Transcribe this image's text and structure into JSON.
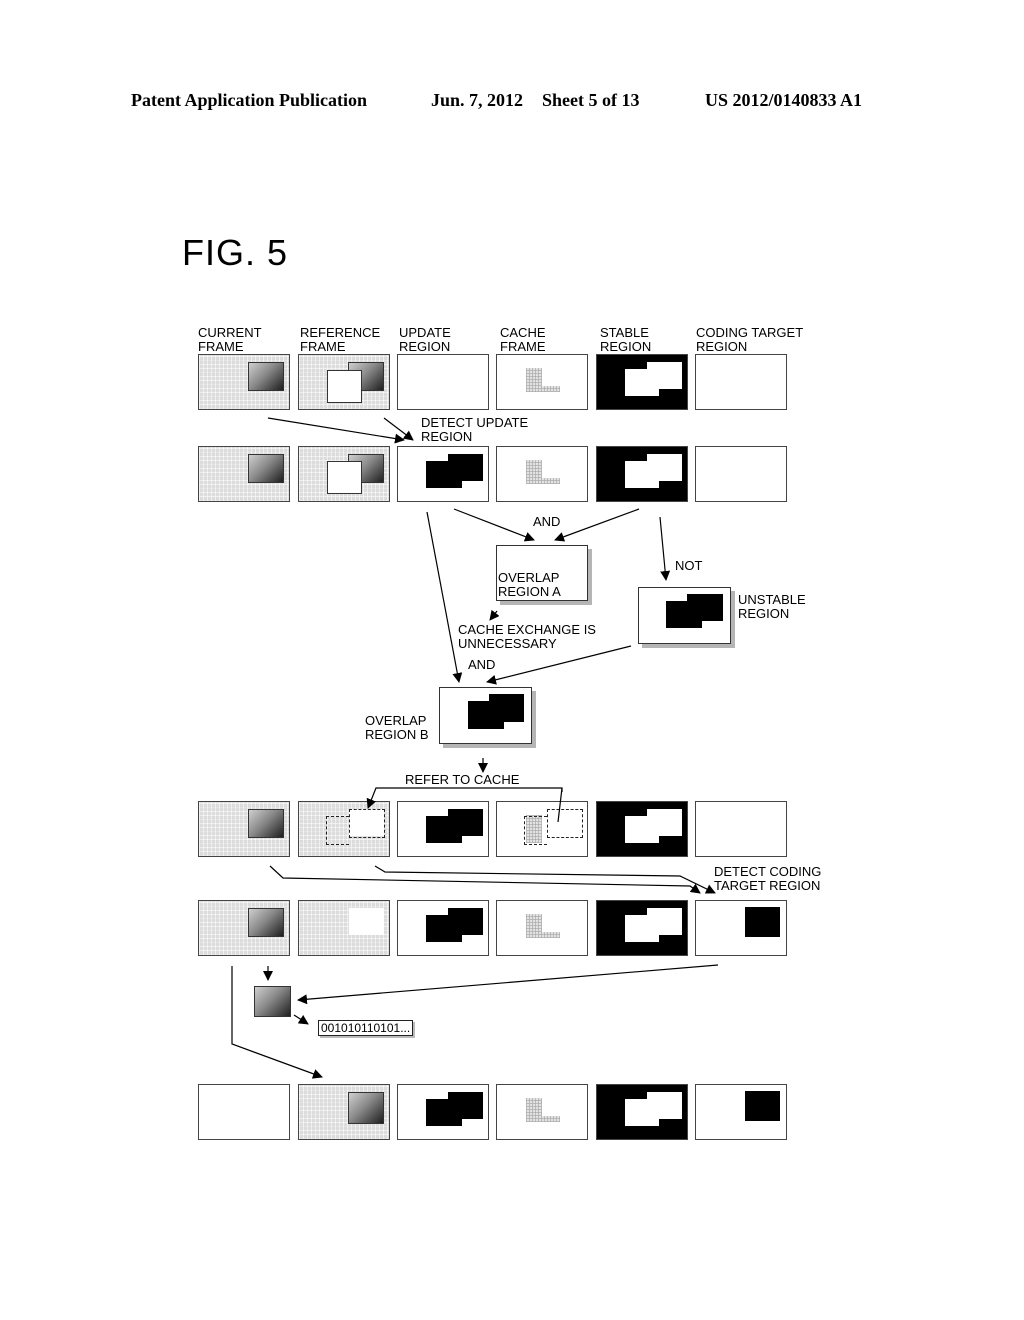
{
  "header": {
    "publication": "Patent Application Publication",
    "date": "Jun. 7, 2012",
    "sheet": "Sheet 5 of 13",
    "patent_number": "US 2012/0140833 A1"
  },
  "figure": {
    "title": "FIG. 5",
    "column_labels": [
      "CURRENT\nFRAME",
      "REFERENCE\nFRAME",
      "UPDATE\nREGION",
      "CACHE\nFRAME",
      "STABLE\nREGION",
      "CODING TARGET\nREGION"
    ],
    "annotations": {
      "detect_update": "DETECT UPDATE\nREGION",
      "and_1": "AND",
      "not": "NOT",
      "overlap_a": "OVERLAP\nREGION A",
      "unstable": "UNSTABLE\nREGION",
      "cache_exchange": "CACHE EXCHANGE IS\nUNNECESSARY",
      "and_2": "AND",
      "overlap_b": "OVERLAP\nREGION B",
      "refer_to_cache": "REFER TO CACHE",
      "detect_coding": "DETECT CODING\nTARGET REGION",
      "bitstream": "001010110101..."
    },
    "colors": {
      "line": "#000000",
      "grid_fill": "#dcdcdc",
      "shadow": "#b5b5b5"
    }
  }
}
